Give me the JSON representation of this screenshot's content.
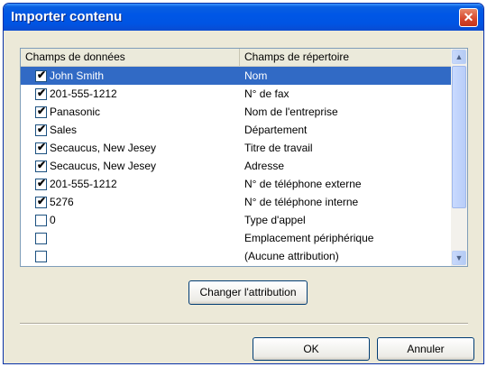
{
  "window": {
    "title": "Importer contenu",
    "close_glyph": "✕"
  },
  "listview": {
    "headers": [
      "Champs de données",
      "Champs de répertoire"
    ],
    "rows": [
      {
        "checked": true,
        "data": "John Smith",
        "field": "Nom",
        "selected": true
      },
      {
        "checked": true,
        "data": "201-555-1212",
        "field": "N° de fax"
      },
      {
        "checked": true,
        "data": "Panasonic",
        "field": "Nom de l'entreprise"
      },
      {
        "checked": true,
        "data": "Sales",
        "field": "Département"
      },
      {
        "checked": true,
        "data": "Secaucus, New Jesey",
        "field": "Titre de travail"
      },
      {
        "checked": true,
        "data": "Secaucus, New Jesey",
        "field": "Adresse"
      },
      {
        "checked": true,
        "data": "201-555-1212",
        "field": "N° de téléphone externe"
      },
      {
        "checked": true,
        "data": "5276",
        "field": "N° de téléphone interne"
      },
      {
        "checked": false,
        "data": "0",
        "field": "Type d'appel"
      },
      {
        "checked": false,
        "data": "",
        "field": "Emplacement périphérique"
      },
      {
        "checked": false,
        "data": "",
        "field": "(Aucune attribution)"
      }
    ],
    "scroll_up_glyph": "▲",
    "scroll_down_glyph": "▼"
  },
  "buttons": {
    "change": "Changer l'attribution",
    "ok": "OK",
    "cancel": "Annuler"
  }
}
